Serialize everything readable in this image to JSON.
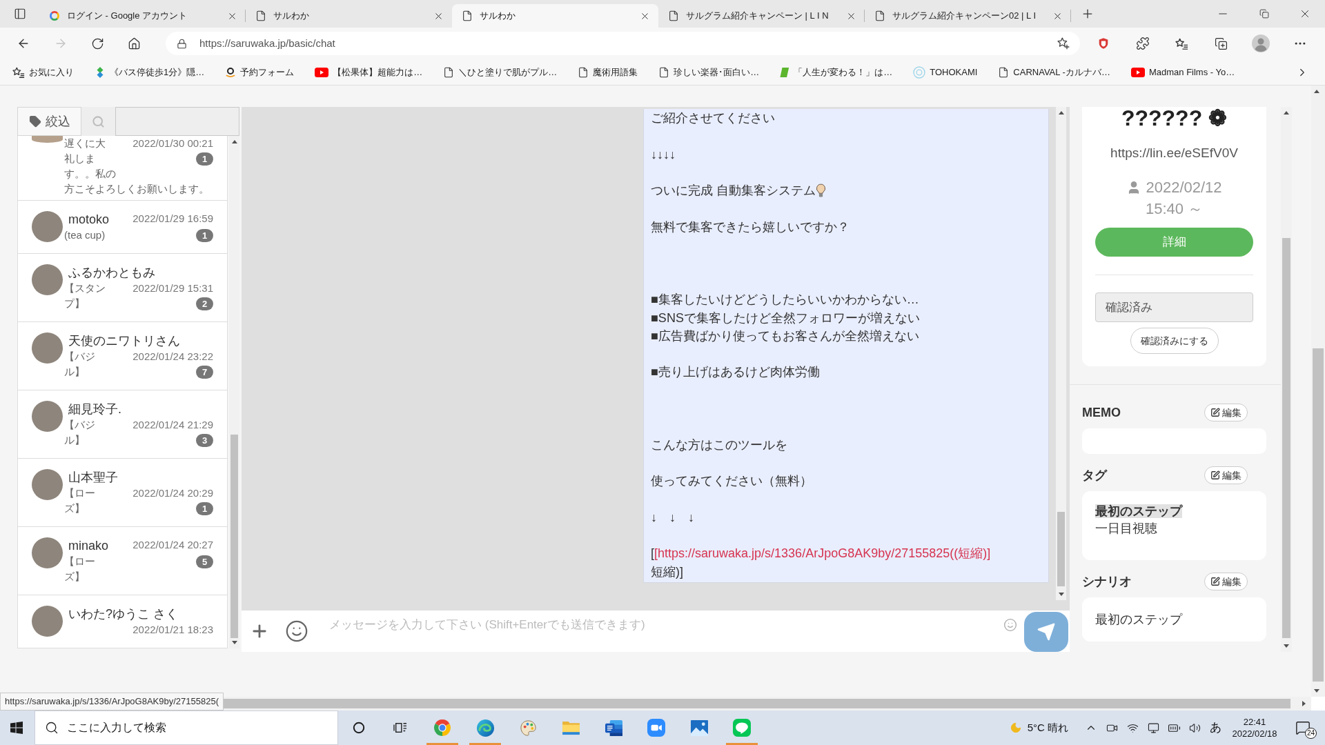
{
  "browser": {
    "tabs": [
      {
        "title": "ログイン - Google アカウント",
        "kind": "google",
        "selected": false
      },
      {
        "title": "サルわか",
        "kind": "page",
        "selected": false
      },
      {
        "title": "サルわか",
        "kind": "page",
        "selected": true
      },
      {
        "title": "サルグラム紹介キャンペーン | L I N",
        "kind": "page",
        "selected": false
      },
      {
        "title": "サルグラム紹介キャンペーン02 | L I",
        "kind": "page",
        "selected": false
      }
    ],
    "forward": {
      "disabled": true
    },
    "url": "https://saruwaka.jp/basic/chat",
    "bookmarks": [
      {
        "label": "お気に入り",
        "kind": "favorites"
      },
      {
        "label": "《バス停徒歩1分》隠…",
        "kind": "diamond"
      },
      {
        "label": "予約フォーム",
        "kind": "smile"
      },
      {
        "label": "【松果体】超能力は…",
        "kind": "video"
      },
      {
        "label": "＼ひと塗りで肌がプル…",
        "kind": "page"
      },
      {
        "label": "魔術用語集",
        "kind": "page"
      },
      {
        "label": "珍しい楽器･面白い…",
        "kind": "page"
      },
      {
        "label": "「人生が変わる！」は…",
        "kind": "tile"
      },
      {
        "label": "TOHOKAMI",
        "kind": "ring"
      },
      {
        "label": "CARNAVAL -カルナバ…",
        "kind": "page"
      },
      {
        "label": "Madman Films - Yo…",
        "kind": "video"
      }
    ],
    "status_url": "https://saruwaka.jp/s/1336/ArJpoG8AK9by/27155825("
  },
  "chat_list": {
    "filter_button": "絞込",
    "items": [
      {
        "kind": "clipped",
        "date": "2022/01/30 00:21",
        "preview": "遅くに大礼しま",
        "unread": "1",
        "preview_more": [
          "す。。私の",
          "方こそよろしくお願いします。"
        ]
      },
      {
        "kind": "full",
        "name": "motoko",
        "date": "2022/01/29 16:59",
        "preview": "(tea cup)",
        "unread": "1"
      },
      {
        "kind": "full",
        "name": "ふるかわともみ",
        "date": "2022/01/29 15:31",
        "preview": "【スタンプ】",
        "unread": "2"
      },
      {
        "kind": "full",
        "name": "天使のニワトリさん",
        "date": "2022/01/24 23:22",
        "preview": "【バジル】",
        "unread": "7"
      },
      {
        "kind": "full",
        "name": "細見玲子.",
        "date": "2022/01/24 21:29",
        "preview": "【バジル】",
        "unread": "3"
      },
      {
        "kind": "full",
        "name": "山本聖子",
        "date": "2022/01/24 20:29",
        "preview": "【ローズ】",
        "unread": "1"
      },
      {
        "kind": "full",
        "name": "minako",
        "date": "2022/01/24 20:27",
        "preview": "【ローズ】",
        "unread": "5"
      },
      {
        "kind": "full",
        "name": "いわた?ゆうこ さく",
        "date": "2022/01/21 18:23"
      }
    ]
  },
  "chat": {
    "message": {
      "lines": [
        {
          "kind": "text",
          "text": "ご紹介させてください"
        },
        {
          "kind": "blank"
        },
        {
          "kind": "text",
          "text": "↓↓↓↓"
        },
        {
          "kind": "blank"
        },
        {
          "kind": "emoji",
          "text": "ついに完成 自動集客システム"
        },
        {
          "kind": "blank"
        },
        {
          "kind": "text",
          "text": "無料で集客できたら嬉しいですか？"
        },
        {
          "kind": "blank"
        },
        {
          "kind": "blank"
        },
        {
          "kind": "blank"
        },
        {
          "kind": "text",
          "text": "■集客したいけどどうしたらいいかわからない…"
        },
        {
          "kind": "text",
          "text": "■SNSで集客したけど全然フォロワーが増えない"
        },
        {
          "kind": "text",
          "text": "■広告費ばかり使ってもお客さんが全然増えない"
        },
        {
          "kind": "blank"
        },
        {
          "kind": "text",
          "text": "■売り上げはあるけど肉体労働"
        },
        {
          "kind": "blank"
        },
        {
          "kind": "blank"
        },
        {
          "kind": "blank"
        },
        {
          "kind": "text",
          "text": "こんな方はこのツールを"
        },
        {
          "kind": "blank"
        },
        {
          "kind": "text",
          "text": "使ってみてください（無料）"
        },
        {
          "kind": "blank"
        },
        {
          "kind": "text",
          "text": "↓　↓　↓"
        },
        {
          "kind": "blank"
        },
        {
          "kind": "link",
          "before": "[",
          "link": "[https://saruwaka.jp/s/1336/ArJpoG8AK9by/27155825((短縮)]",
          "after": "短縮)]"
        }
      ]
    },
    "composer": {
      "placeholder": "メッセージを入力して下さい (Shift+Enterでも送信できます)"
    }
  },
  "profile": {
    "name": "?????? ❁",
    "url": "https://lin.ee/eSEfV0V",
    "date": "2022/02/12",
    "time": "15:40 ～",
    "detail_button": "詳細",
    "status": {
      "value": "確認済み",
      "disabled": true
    },
    "confirm_button": "確認済みにする"
  },
  "sections": [
    {
      "kind": "memo",
      "title": "MEMO",
      "edit_button": "編集"
    },
    {
      "kind": "tags",
      "title": "タグ",
      "edit_button": "編集",
      "groups": [
        {
          "label": "最初のステップ",
          "children": [
            {
              "label": "一日目視聴"
            }
          ]
        }
      ]
    },
    {
      "kind": "scenario",
      "title": "シナリオ",
      "edit_button": "編集",
      "value": "最初のステップ"
    }
  ],
  "taskbar": {
    "search_placeholder": "ここに入力して検索",
    "apps": [
      {
        "kind": "wheel",
        "running": true
      },
      {
        "kind": "swirl",
        "running": true
      },
      {
        "kind": "palette",
        "running": false
      },
      {
        "kind": "folder",
        "running": false
      },
      {
        "kind": "document",
        "running": false
      },
      {
        "kind": "camera",
        "running": false
      },
      {
        "kind": "picture",
        "running": false
      },
      {
        "kind": "bubble",
        "running": true
      }
    ],
    "weather": "5°C 晴れ",
    "ime": "あ",
    "time": "22:41",
    "date": "2022/02/18",
    "notifications": "24"
  }
}
